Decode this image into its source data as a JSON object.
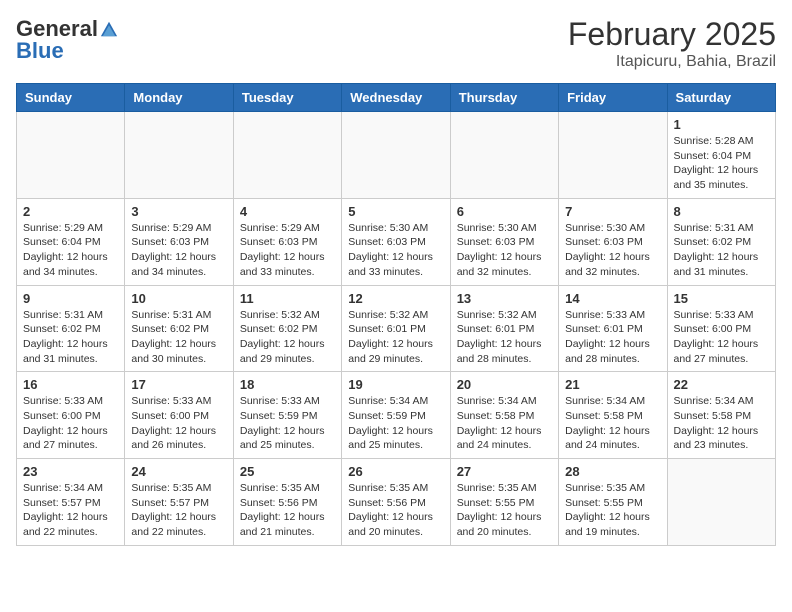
{
  "header": {
    "logo_general": "General",
    "logo_blue": "Blue",
    "month_year": "February 2025",
    "location": "Itapicuru, Bahia, Brazil"
  },
  "days_of_week": [
    "Sunday",
    "Monday",
    "Tuesday",
    "Wednesday",
    "Thursday",
    "Friday",
    "Saturday"
  ],
  "weeks": [
    {
      "days": [
        {
          "num": "",
          "detail": ""
        },
        {
          "num": "",
          "detail": ""
        },
        {
          "num": "",
          "detail": ""
        },
        {
          "num": "",
          "detail": ""
        },
        {
          "num": "",
          "detail": ""
        },
        {
          "num": "",
          "detail": ""
        },
        {
          "num": "1",
          "detail": "Sunrise: 5:28 AM\nSunset: 6:04 PM\nDaylight: 12 hours\nand 35 minutes."
        }
      ]
    },
    {
      "days": [
        {
          "num": "2",
          "detail": "Sunrise: 5:29 AM\nSunset: 6:04 PM\nDaylight: 12 hours\nand 34 minutes."
        },
        {
          "num": "3",
          "detail": "Sunrise: 5:29 AM\nSunset: 6:03 PM\nDaylight: 12 hours\nand 34 minutes."
        },
        {
          "num": "4",
          "detail": "Sunrise: 5:29 AM\nSunset: 6:03 PM\nDaylight: 12 hours\nand 33 minutes."
        },
        {
          "num": "5",
          "detail": "Sunrise: 5:30 AM\nSunset: 6:03 PM\nDaylight: 12 hours\nand 33 minutes."
        },
        {
          "num": "6",
          "detail": "Sunrise: 5:30 AM\nSunset: 6:03 PM\nDaylight: 12 hours\nand 32 minutes."
        },
        {
          "num": "7",
          "detail": "Sunrise: 5:30 AM\nSunset: 6:03 PM\nDaylight: 12 hours\nand 32 minutes."
        },
        {
          "num": "8",
          "detail": "Sunrise: 5:31 AM\nSunset: 6:02 PM\nDaylight: 12 hours\nand 31 minutes."
        }
      ]
    },
    {
      "days": [
        {
          "num": "9",
          "detail": "Sunrise: 5:31 AM\nSunset: 6:02 PM\nDaylight: 12 hours\nand 31 minutes."
        },
        {
          "num": "10",
          "detail": "Sunrise: 5:31 AM\nSunset: 6:02 PM\nDaylight: 12 hours\nand 30 minutes."
        },
        {
          "num": "11",
          "detail": "Sunrise: 5:32 AM\nSunset: 6:02 PM\nDaylight: 12 hours\nand 29 minutes."
        },
        {
          "num": "12",
          "detail": "Sunrise: 5:32 AM\nSunset: 6:01 PM\nDaylight: 12 hours\nand 29 minutes."
        },
        {
          "num": "13",
          "detail": "Sunrise: 5:32 AM\nSunset: 6:01 PM\nDaylight: 12 hours\nand 28 minutes."
        },
        {
          "num": "14",
          "detail": "Sunrise: 5:33 AM\nSunset: 6:01 PM\nDaylight: 12 hours\nand 28 minutes."
        },
        {
          "num": "15",
          "detail": "Sunrise: 5:33 AM\nSunset: 6:00 PM\nDaylight: 12 hours\nand 27 minutes."
        }
      ]
    },
    {
      "days": [
        {
          "num": "16",
          "detail": "Sunrise: 5:33 AM\nSunset: 6:00 PM\nDaylight: 12 hours\nand 27 minutes."
        },
        {
          "num": "17",
          "detail": "Sunrise: 5:33 AM\nSunset: 6:00 PM\nDaylight: 12 hours\nand 26 minutes."
        },
        {
          "num": "18",
          "detail": "Sunrise: 5:33 AM\nSunset: 5:59 PM\nDaylight: 12 hours\nand 25 minutes."
        },
        {
          "num": "19",
          "detail": "Sunrise: 5:34 AM\nSunset: 5:59 PM\nDaylight: 12 hours\nand 25 minutes."
        },
        {
          "num": "20",
          "detail": "Sunrise: 5:34 AM\nSunset: 5:58 PM\nDaylight: 12 hours\nand 24 minutes."
        },
        {
          "num": "21",
          "detail": "Sunrise: 5:34 AM\nSunset: 5:58 PM\nDaylight: 12 hours\nand 24 minutes."
        },
        {
          "num": "22",
          "detail": "Sunrise: 5:34 AM\nSunset: 5:58 PM\nDaylight: 12 hours\nand 23 minutes."
        }
      ]
    },
    {
      "days": [
        {
          "num": "23",
          "detail": "Sunrise: 5:34 AM\nSunset: 5:57 PM\nDaylight: 12 hours\nand 22 minutes."
        },
        {
          "num": "24",
          "detail": "Sunrise: 5:35 AM\nSunset: 5:57 PM\nDaylight: 12 hours\nand 22 minutes."
        },
        {
          "num": "25",
          "detail": "Sunrise: 5:35 AM\nSunset: 5:56 PM\nDaylight: 12 hours\nand 21 minutes."
        },
        {
          "num": "26",
          "detail": "Sunrise: 5:35 AM\nSunset: 5:56 PM\nDaylight: 12 hours\nand 20 minutes."
        },
        {
          "num": "27",
          "detail": "Sunrise: 5:35 AM\nSunset: 5:55 PM\nDaylight: 12 hours\nand 20 minutes."
        },
        {
          "num": "28",
          "detail": "Sunrise: 5:35 AM\nSunset: 5:55 PM\nDaylight: 12 hours\nand 19 minutes."
        },
        {
          "num": "",
          "detail": ""
        }
      ]
    }
  ]
}
